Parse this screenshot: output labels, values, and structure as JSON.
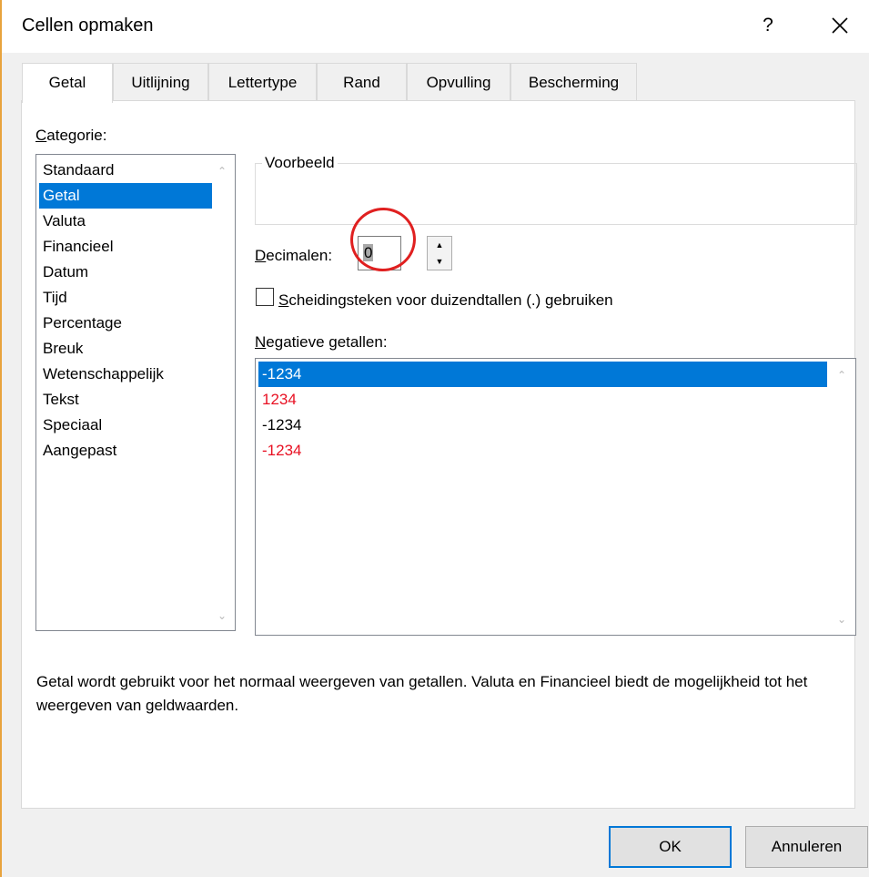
{
  "window": {
    "title": "Cellen opmaken",
    "help_label": "?",
    "close_icon": "close-icon"
  },
  "tabs": [
    {
      "label": "Getal",
      "active": true
    },
    {
      "label": "Uitlijning",
      "active": false
    },
    {
      "label": "Lettertype",
      "active": false
    },
    {
      "label": "Rand",
      "active": false
    },
    {
      "label": "Opvulling",
      "active": false
    },
    {
      "label": "Bescherming",
      "active": false
    }
  ],
  "category": {
    "label_first": "C",
    "label_rest": "ategorie:",
    "items": [
      "Standaard",
      "Getal",
      "Valuta",
      "Financieel",
      "Datum",
      "Tijd",
      "Percentage",
      "Breuk",
      "Wetenschappelijk",
      "Tekst",
      "Speciaal",
      "Aangepast"
    ],
    "selected": "Getal"
  },
  "preview": {
    "title": "Voorbeeld"
  },
  "decimals": {
    "label_first": "D",
    "label_rest": "ecimalen:",
    "value": "0"
  },
  "separator": {
    "label_first": "S",
    "label_rest": "cheidingsteken voor duizendtallen (.) gebruiken",
    "checked": false
  },
  "negative": {
    "label_first": "N",
    "label_rest": "egatieve getallen:",
    "items": [
      {
        "text": "-1234",
        "color": "#ffffff",
        "selected": true
      },
      {
        "text": "1234",
        "color": "#e81123",
        "selected": false
      },
      {
        "text": "-1234",
        "color": "#000000",
        "selected": false
      },
      {
        "text": "-1234",
        "color": "#e81123",
        "selected": false
      }
    ]
  },
  "description": "Getal wordt gebruikt voor het normaal weergeven van getallen. Valuta en Financieel biedt de mogelijkheid tot het weergeven van geldwaarden.",
  "buttons": {
    "ok": "OK",
    "cancel": "Annuleren"
  },
  "colors": {
    "selection": "#0078d7",
    "annotation": "#e02020",
    "window_accent": "#e8a33d"
  }
}
